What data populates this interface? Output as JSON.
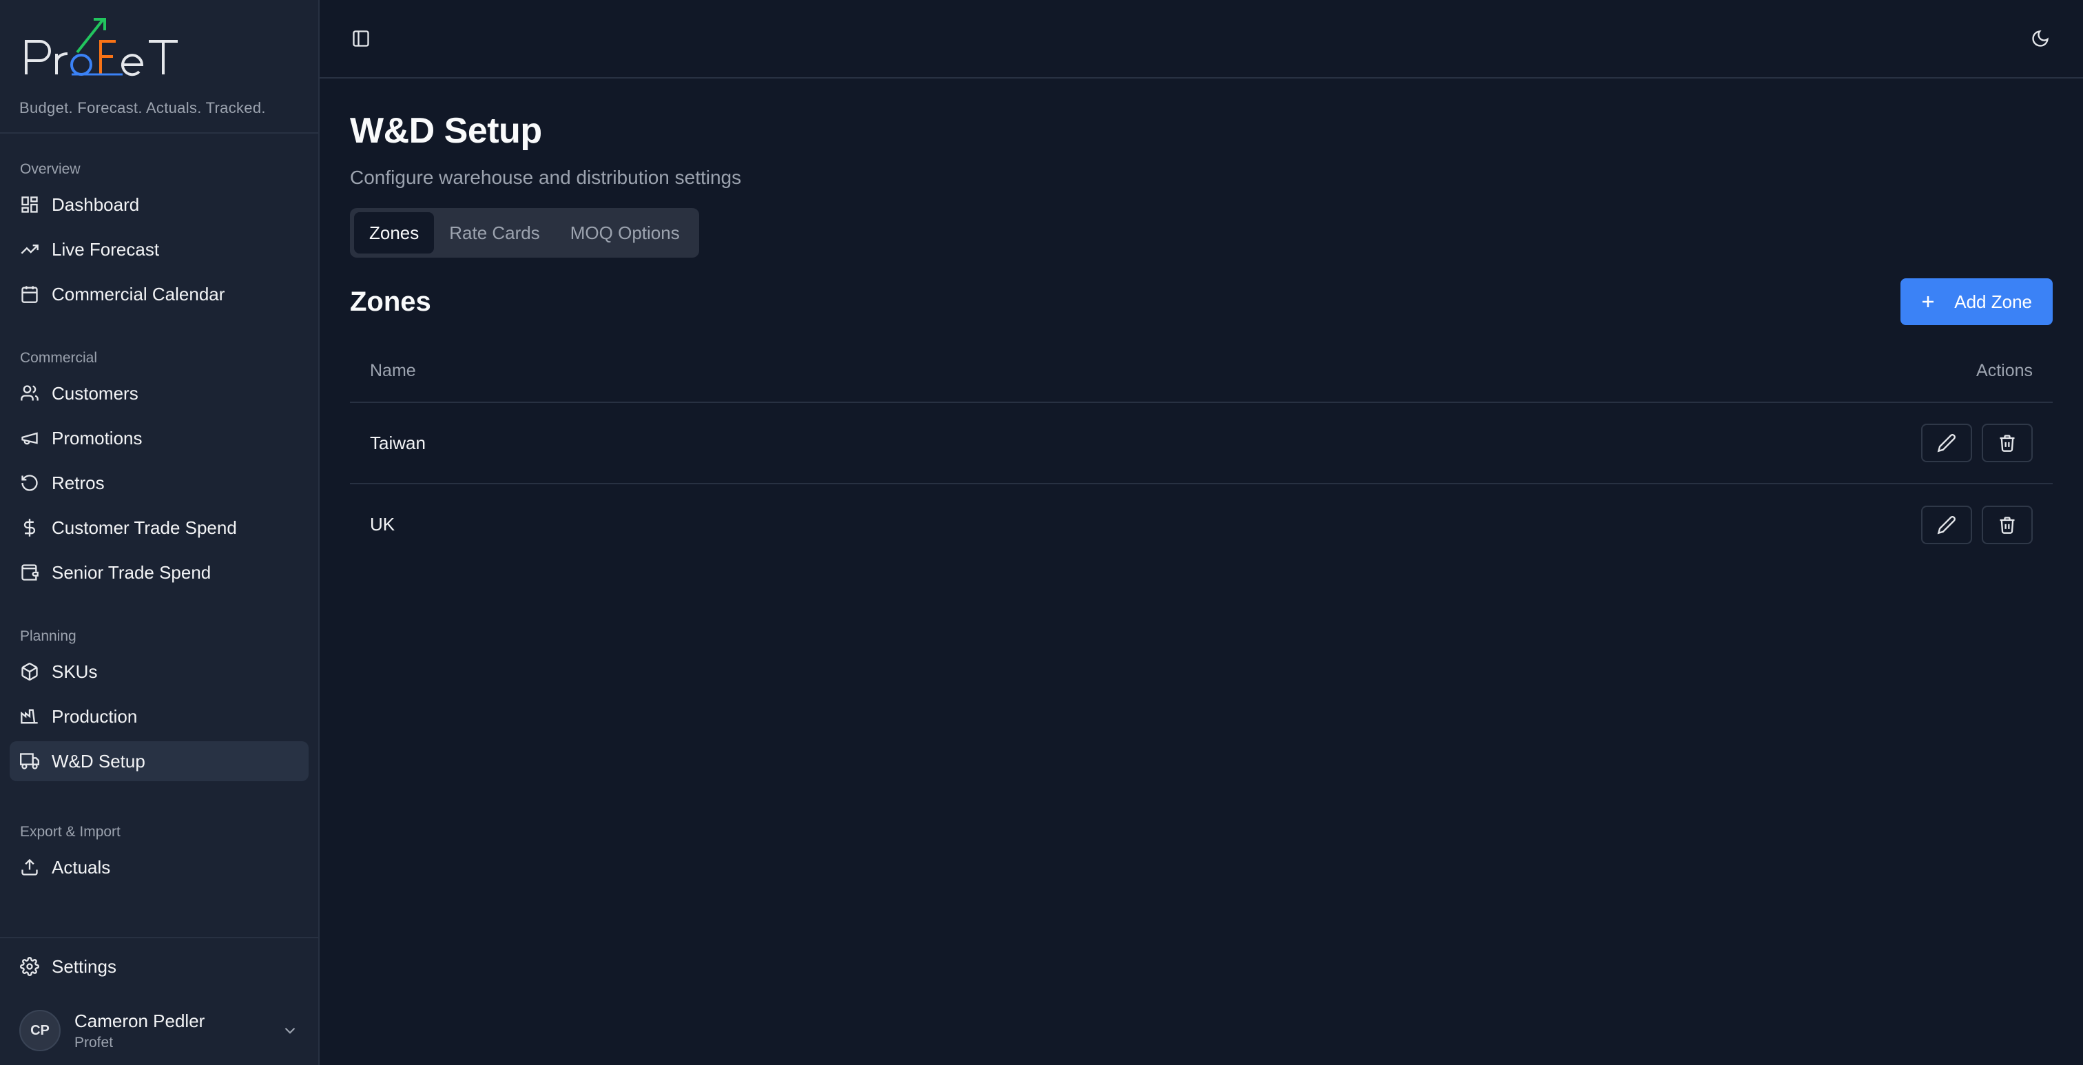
{
  "brand": {
    "logo_text": "ProFeT",
    "tagline": "Budget. Forecast. Actuals. Tracked.",
    "colors": {
      "arrow": "#22c55e",
      "accent_orange": "#f97316",
      "accent_blue": "#3b82f6"
    }
  },
  "sidebar": {
    "groups": [
      {
        "label": "Overview",
        "items": [
          {
            "label": "Dashboard",
            "icon": "layout-dashboard-icon"
          },
          {
            "label": "Live Forecast",
            "icon": "trending-up-icon"
          },
          {
            "label": "Commercial Calendar",
            "icon": "calendar-icon"
          }
        ]
      },
      {
        "label": "Commercial",
        "items": [
          {
            "label": "Customers",
            "icon": "users-icon"
          },
          {
            "label": "Promotions",
            "icon": "megaphone-icon"
          },
          {
            "label": "Retros",
            "icon": "rotate-ccw-icon"
          },
          {
            "label": "Customer Trade Spend",
            "icon": "dollar-sign-icon"
          },
          {
            "label": "Senior Trade Spend",
            "icon": "wallet-icon"
          }
        ]
      },
      {
        "label": "Planning",
        "items": [
          {
            "label": "SKUs",
            "icon": "package-icon"
          },
          {
            "label": "Production",
            "icon": "factory-icon"
          },
          {
            "label": "W&D Setup",
            "icon": "truck-icon",
            "active": true
          }
        ]
      },
      {
        "label": "Export & Import",
        "items": [
          {
            "label": "Actuals",
            "icon": "upload-icon"
          }
        ]
      }
    ],
    "settings_label": "Settings",
    "user": {
      "initials": "CP",
      "name": "Cameron Pedler",
      "org": "Profet"
    }
  },
  "header": {
    "title": "W&D Setup",
    "subtitle": "Configure warehouse and distribution settings"
  },
  "tabs": [
    {
      "label": "Zones",
      "active": true
    },
    {
      "label": "Rate Cards"
    },
    {
      "label": "MOQ Options"
    }
  ],
  "zones": {
    "title": "Zones",
    "add_label": "Add Zone",
    "columns": {
      "name": "Name",
      "actions": "Actions"
    },
    "rows": [
      {
        "name": "Taiwan"
      },
      {
        "name": "UK"
      }
    ]
  }
}
